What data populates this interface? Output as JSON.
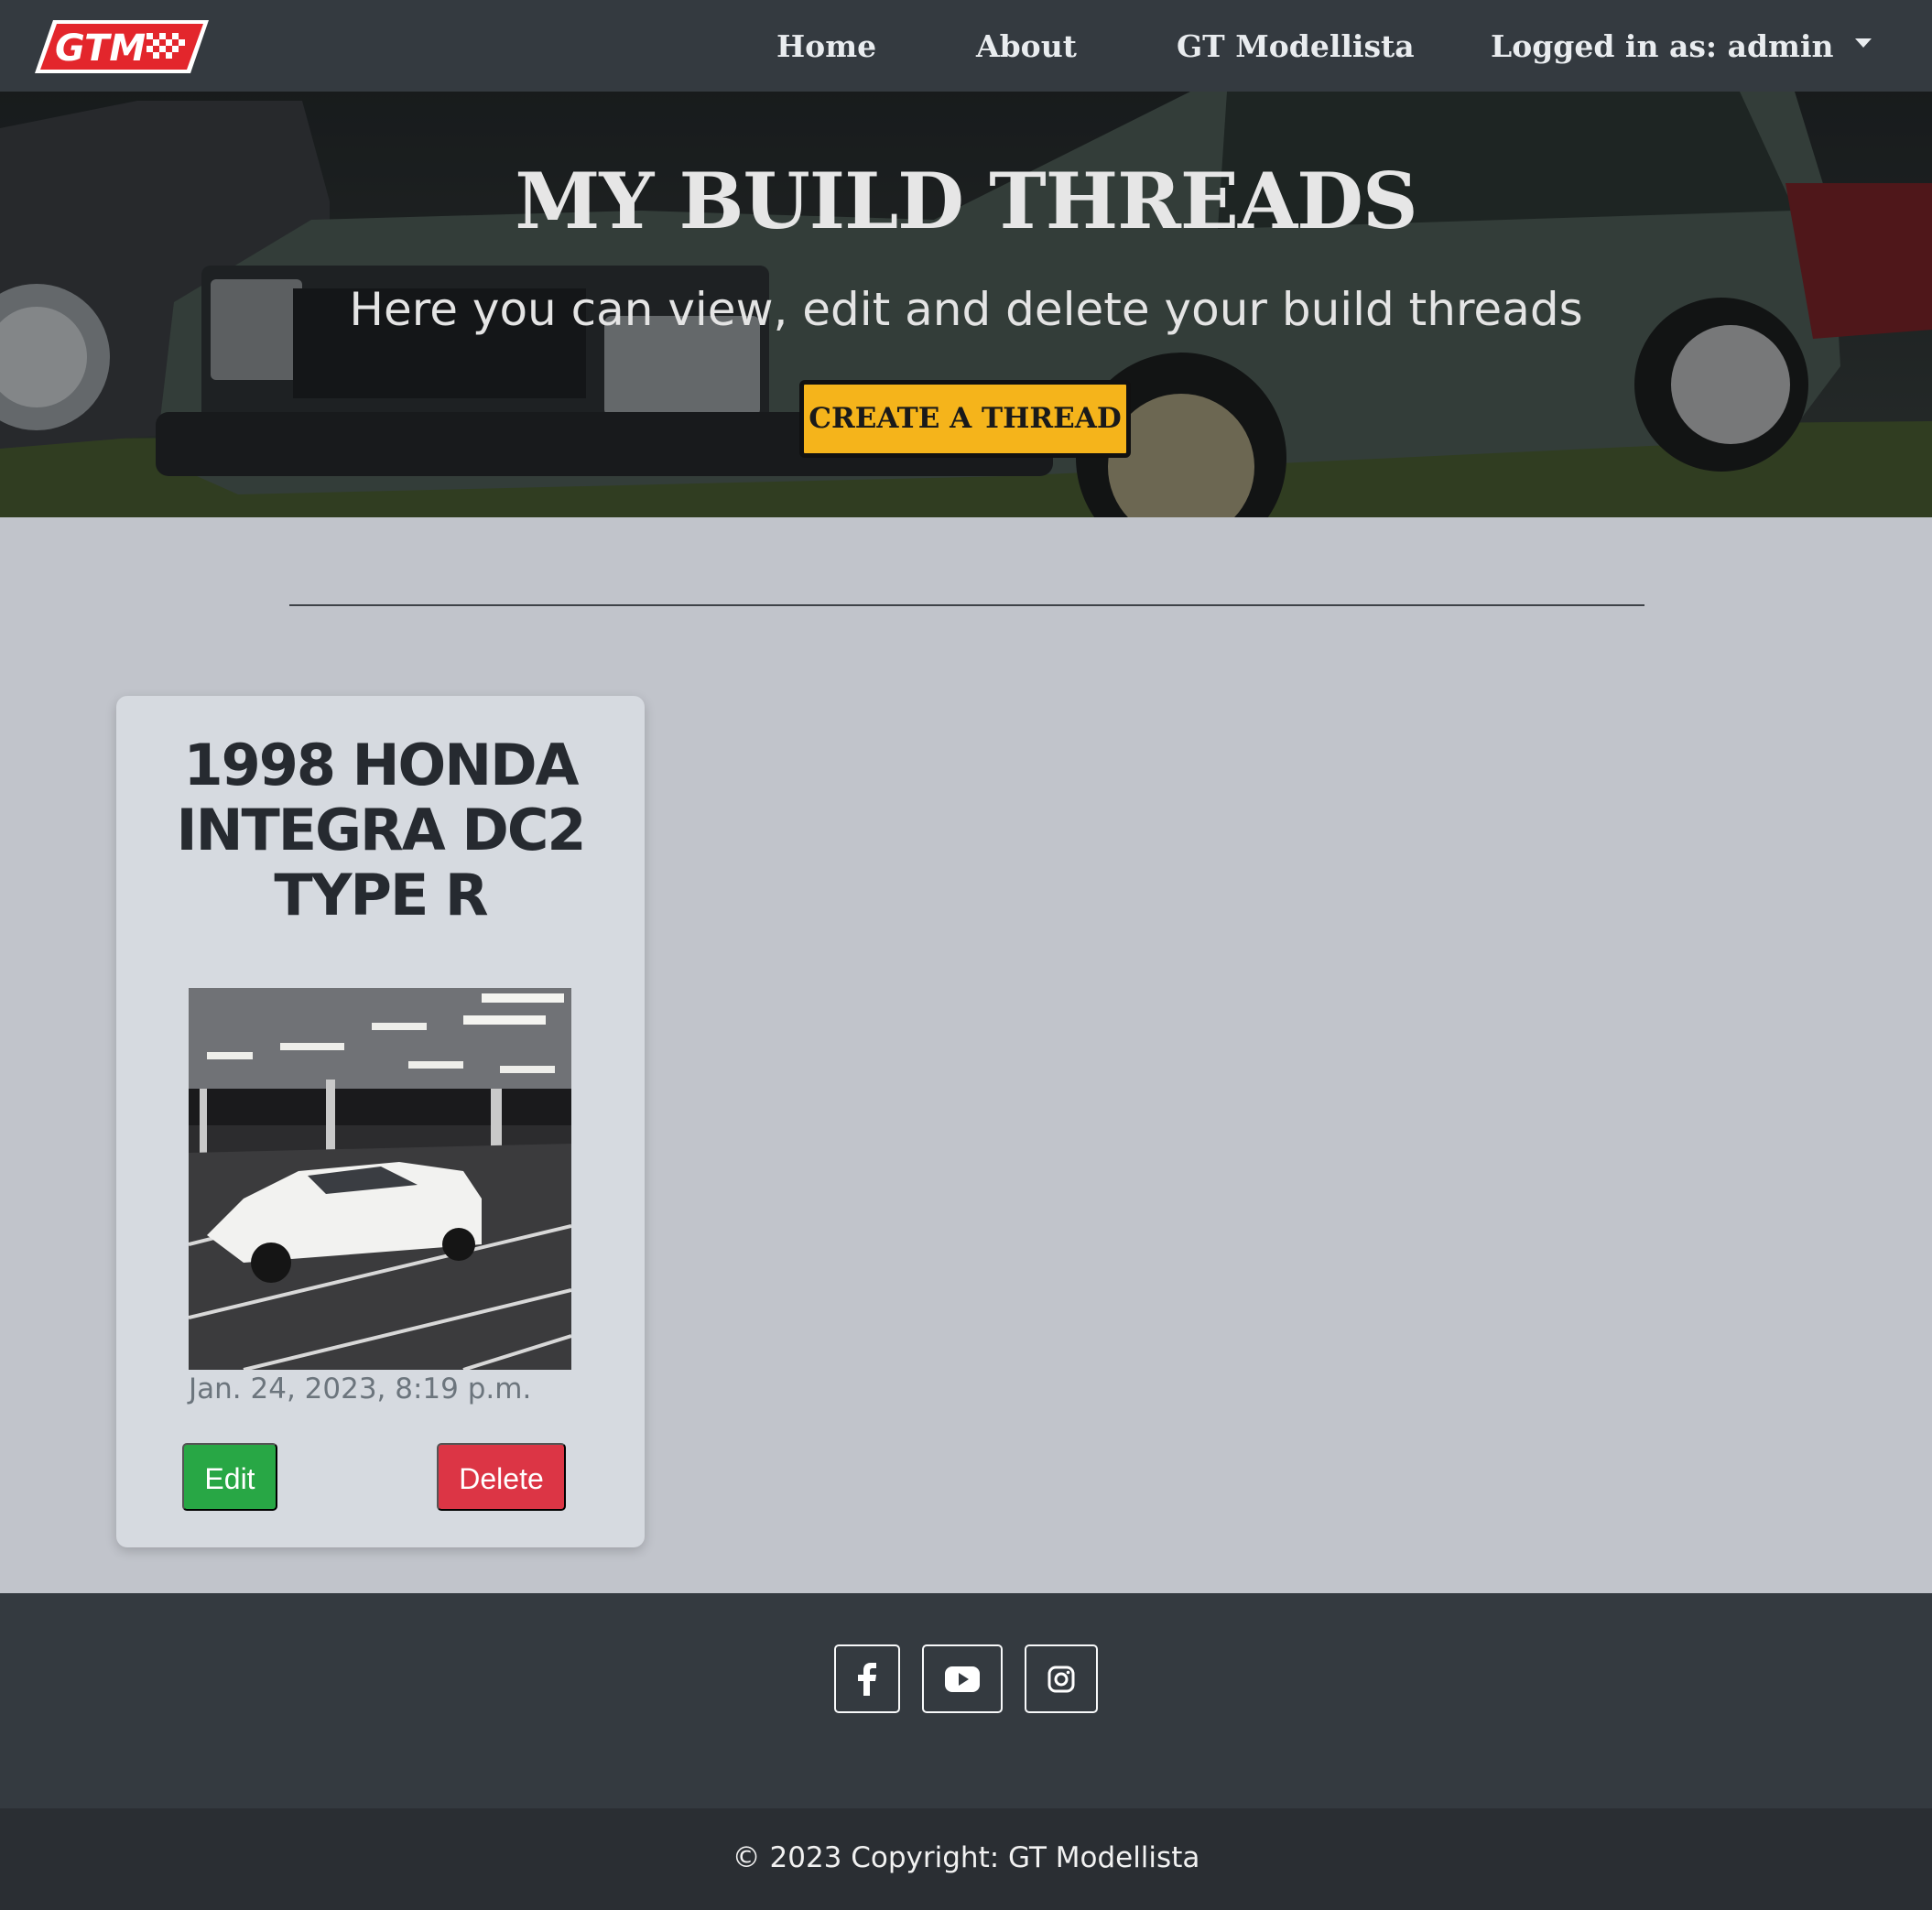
{
  "navbar": {
    "logo_text": "GTM",
    "links": {
      "home": "Home",
      "about": "About",
      "gt_modellista": "GT Modellista"
    },
    "user_label": "Logged in as: admin",
    "dropdown_icon": "caret-down-icon"
  },
  "hero": {
    "title": "MY BUILD THREADS",
    "subtitle": "Here you can view, edit and delete your build threads",
    "create_button": "CREATE A THREAD"
  },
  "threads": [
    {
      "title": "1998 HONDA INTEGRA DC2 TYPE R",
      "date": "Jan. 24, 2023, 8:19 p.m.",
      "edit_label": "Edit",
      "delete_label": "Delete"
    }
  ],
  "footer": {
    "social_icons": [
      "facebook-icon",
      "youtube-icon",
      "instagram-icon"
    ],
    "copyright": "© 2023 Copyright: GT Modellista"
  },
  "colors": {
    "navbar": "#343a40",
    "page_bg": "#c1c4cb",
    "card_bg": "#d6dae0",
    "create_button": "#f5b41b",
    "edit_button": "#28a745",
    "delete_button": "#dc3545",
    "logo_red": "#e3262c"
  }
}
